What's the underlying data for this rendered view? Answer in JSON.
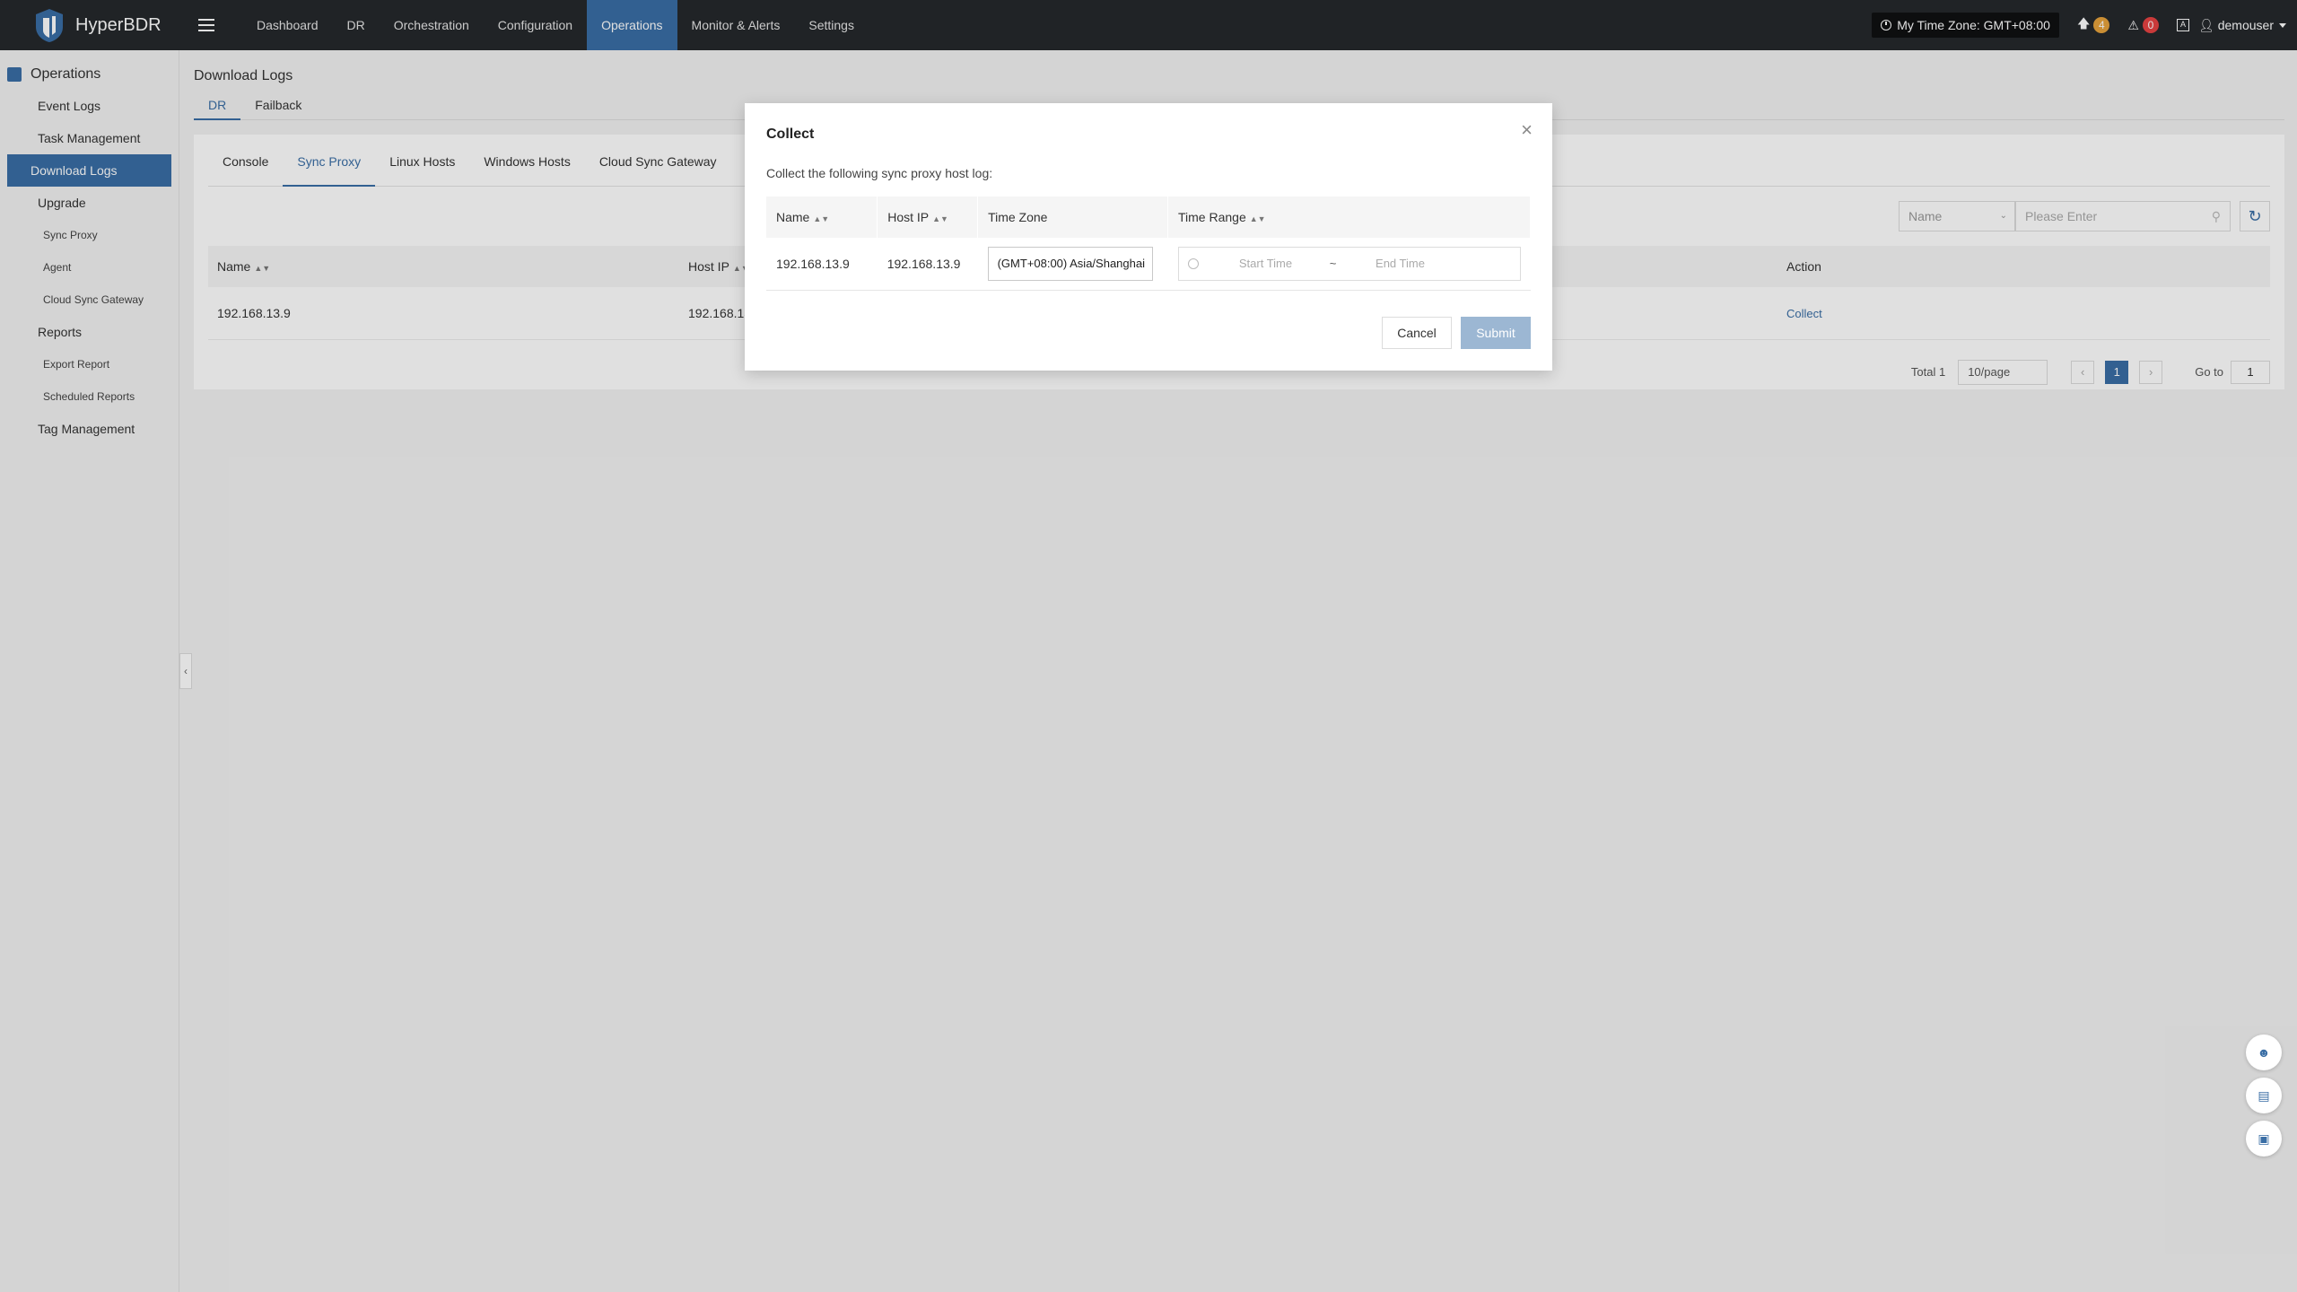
{
  "app": {
    "name": "HyperBDR"
  },
  "nav": {
    "items": [
      "Dashboard",
      "DR",
      "Orchestration",
      "Configuration",
      "Operations",
      "Monitor & Alerts",
      "Settings"
    ],
    "active": "Operations"
  },
  "header": {
    "timezone": "My Time Zone: GMT+08:00",
    "upload_count": "4",
    "alert_count": "0",
    "username": "demouser"
  },
  "sidebar": {
    "section": "Operations",
    "items": {
      "event_logs": "Event Logs",
      "task_management": "Task Management",
      "download_logs": "Download Logs",
      "upgrade": "Upgrade",
      "sync_proxy": "Sync Proxy",
      "agent": "Agent",
      "cloud_sync_gateway": "Cloud Sync Gateway",
      "reports": "Reports",
      "export_report": "Export Report",
      "scheduled_reports": "Scheduled Reports",
      "tag_management": "Tag Management"
    }
  },
  "page": {
    "title": "Download Logs",
    "tabs": {
      "dr": "DR",
      "failback": "Failback"
    },
    "sub_tabs": {
      "console": "Console",
      "sync_proxy": "Sync Proxy",
      "linux_hosts": "Linux Hosts",
      "windows_hosts": "Windows Hosts",
      "cloud_sync_gateway": "Cloud Sync Gateway"
    },
    "filter": {
      "field": "Name",
      "placeholder": "Please Enter"
    },
    "table": {
      "headers": {
        "name": "Name",
        "host_ip": "Host IP",
        "action": "Action"
      },
      "rows": [
        {
          "name": "192.168.13.9",
          "host_ip": "192.168.13.9",
          "action": "Collect"
        }
      ]
    },
    "pager": {
      "total": "Total 1",
      "page_size": "10/page",
      "current": "1",
      "goto_label": "Go to",
      "goto_value": "1"
    }
  },
  "modal": {
    "title": "Collect",
    "description": "Collect the following sync proxy host log:",
    "headers": {
      "name": "Name",
      "host_ip": "Host IP",
      "time_zone": "Time Zone",
      "time_range": "Time Range"
    },
    "row": {
      "name": "192.168.13.9",
      "host_ip": "192.168.13.9",
      "time_zone": "(GMT+08:00) Asia/Shanghai",
      "start_placeholder": "Start Time",
      "separator": "~",
      "end_placeholder": "End Time"
    },
    "buttons": {
      "cancel": "Cancel",
      "submit": "Submit"
    }
  },
  "colors": {
    "accent": "#3a6ea5",
    "topbar": "#25282c",
    "submit_disabled": "#9cb7d3"
  }
}
